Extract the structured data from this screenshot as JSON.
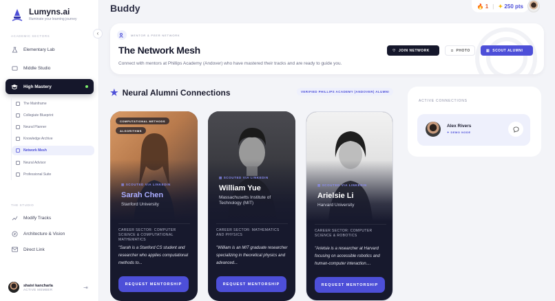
{
  "app": {
    "name": "Lumyns.ai",
    "tagline": "Illuminate your learning journey"
  },
  "sidebar": {
    "academic_label": "ACADEMIC SECTORS",
    "items": [
      {
        "label": "Elementary Lab",
        "icon": "flask-icon"
      },
      {
        "label": "Middle Studio",
        "icon": "palette-icon"
      },
      {
        "label": "High Mastery",
        "icon": "graduation-cap-icon",
        "active": true
      }
    ],
    "sub_items": [
      {
        "label": "The Mainframe"
      },
      {
        "label": "Collegiate Blueprint"
      },
      {
        "label": "Neural Planner"
      },
      {
        "label": "Knowledge Archive"
      },
      {
        "label": "Network Mesh",
        "active": true
      },
      {
        "label": "Neural Advisor"
      },
      {
        "label": "Professional Suite"
      }
    ],
    "studio_label": "THE STUDIO",
    "studio_items": [
      {
        "label": "Modify Tracks",
        "icon": "trend-icon"
      },
      {
        "label": "Architecture & Vision",
        "icon": "compass-icon"
      },
      {
        "label": "Direct Link",
        "icon": "mail-icon"
      }
    ],
    "user": {
      "name": "shaivi kancharla",
      "role": "ACTIVE MEMBER"
    }
  },
  "header": {
    "title": "Buddy",
    "streak": "1",
    "points": "250 pts"
  },
  "hero": {
    "kicker": "MENTOR & PEER NETWORK",
    "title": "The Network Mesh",
    "description": "Connect with mentors at Phillips Academy (Andover) who have mastered their tracks and are ready to guide you.",
    "join_label": "JOIN NETWORK",
    "photo_label": "PHOTO",
    "scout_label": "SCOUT ALUMNI"
  },
  "section": {
    "title": "Neural Alumni Connections",
    "badge": "VERIFIED PHILLIPS ACADEMY (ANDOVER) ALUMNI"
  },
  "cards": [
    {
      "tags": [
        "COMPUTATIONAL METHODS",
        "ALGORITHMS"
      ],
      "scout": "SCOUTED VIA LINKEDIN",
      "name": "Sarah Chen",
      "university": "Stanford University",
      "sector": "CAREER SECTOR: COMPUTER SCIENCE & COMPUTATIONAL MATHEMATICS",
      "quote": "\"Sarah is a Stanford CS student and researcher who applies computational methods to...",
      "button": "REQUEST MENTORSHIP"
    },
    {
      "tags": [],
      "scout": "SCOUTED VIA LINKEDIN",
      "name": "William Yue",
      "university": "Massachusetts Institute of Technology (MIT)",
      "sector": "CAREER SECTOR: MATHEMATICS AND PHYSICS",
      "quote": "\"William is an MIT graduate researcher specializing in theoretical physics and advanced...",
      "button": "REQUEST MENTORSHIP"
    },
    {
      "tags": [],
      "scout": "SCOUTED VIA LINKEDIN",
      "name": "Arielsie Li",
      "university": "Harvard University",
      "sector": "CAREER SECTOR: COMPUTER SCIENCE & ROBOTICS",
      "quote": "\"Arielsie is a researcher at Harvard focusing on accessible robotics and human-computer interaction....",
      "button": "REQUEST MENTORSHIP"
    }
  ],
  "connections": {
    "title": "ACTIVE CONNECTIONS",
    "items": [
      {
        "name": "Alex Rivers",
        "sub": "DEMO NODE"
      }
    ]
  },
  "colors": {
    "accent": "#4d4fd8",
    "dark": "#15172b",
    "active_dot": "#7cf06b"
  }
}
